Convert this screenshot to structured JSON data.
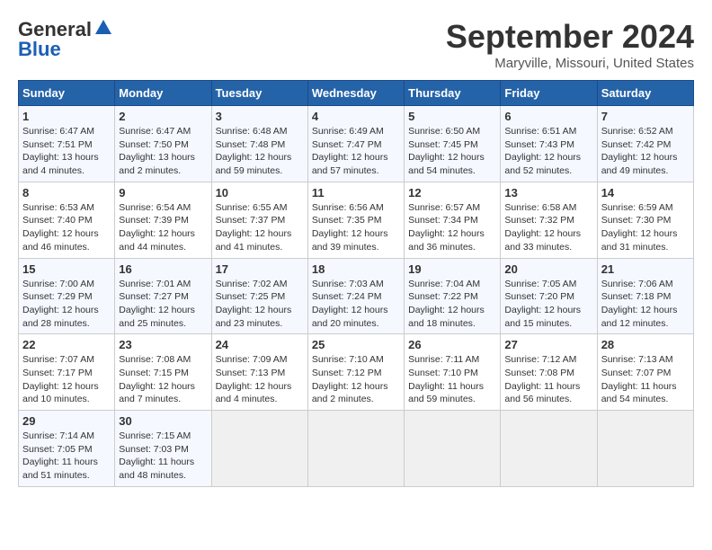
{
  "header": {
    "logo_general": "General",
    "logo_blue": "Blue",
    "month_title": "September 2024",
    "location": "Maryville, Missouri, United States"
  },
  "days_of_week": [
    "Sunday",
    "Monday",
    "Tuesday",
    "Wednesday",
    "Thursday",
    "Friday",
    "Saturday"
  ],
  "weeks": [
    [
      {
        "day": "1",
        "sunrise": "6:47 AM",
        "sunset": "7:51 PM",
        "daylight": "13 hours and 4 minutes."
      },
      {
        "day": "2",
        "sunrise": "6:47 AM",
        "sunset": "7:50 PM",
        "daylight": "13 hours and 2 minutes."
      },
      {
        "day": "3",
        "sunrise": "6:48 AM",
        "sunset": "7:48 PM",
        "daylight": "12 hours and 59 minutes."
      },
      {
        "day": "4",
        "sunrise": "6:49 AM",
        "sunset": "7:47 PM",
        "daylight": "12 hours and 57 minutes."
      },
      {
        "day": "5",
        "sunrise": "6:50 AM",
        "sunset": "7:45 PM",
        "daylight": "12 hours and 54 minutes."
      },
      {
        "day": "6",
        "sunrise": "6:51 AM",
        "sunset": "7:43 PM",
        "daylight": "12 hours and 52 minutes."
      },
      {
        "day": "7",
        "sunrise": "6:52 AM",
        "sunset": "7:42 PM",
        "daylight": "12 hours and 49 minutes."
      }
    ],
    [
      {
        "day": "8",
        "sunrise": "6:53 AM",
        "sunset": "7:40 PM",
        "daylight": "12 hours and 46 minutes."
      },
      {
        "day": "9",
        "sunrise": "6:54 AM",
        "sunset": "7:39 PM",
        "daylight": "12 hours and 44 minutes."
      },
      {
        "day": "10",
        "sunrise": "6:55 AM",
        "sunset": "7:37 PM",
        "daylight": "12 hours and 41 minutes."
      },
      {
        "day": "11",
        "sunrise": "6:56 AM",
        "sunset": "7:35 PM",
        "daylight": "12 hours and 39 minutes."
      },
      {
        "day": "12",
        "sunrise": "6:57 AM",
        "sunset": "7:34 PM",
        "daylight": "12 hours and 36 minutes."
      },
      {
        "day": "13",
        "sunrise": "6:58 AM",
        "sunset": "7:32 PM",
        "daylight": "12 hours and 33 minutes."
      },
      {
        "day": "14",
        "sunrise": "6:59 AM",
        "sunset": "7:30 PM",
        "daylight": "12 hours and 31 minutes."
      }
    ],
    [
      {
        "day": "15",
        "sunrise": "7:00 AM",
        "sunset": "7:29 PM",
        "daylight": "12 hours and 28 minutes."
      },
      {
        "day": "16",
        "sunrise": "7:01 AM",
        "sunset": "7:27 PM",
        "daylight": "12 hours and 25 minutes."
      },
      {
        "day": "17",
        "sunrise": "7:02 AM",
        "sunset": "7:25 PM",
        "daylight": "12 hours and 23 minutes."
      },
      {
        "day": "18",
        "sunrise": "7:03 AM",
        "sunset": "7:24 PM",
        "daylight": "12 hours and 20 minutes."
      },
      {
        "day": "19",
        "sunrise": "7:04 AM",
        "sunset": "7:22 PM",
        "daylight": "12 hours and 18 minutes."
      },
      {
        "day": "20",
        "sunrise": "7:05 AM",
        "sunset": "7:20 PM",
        "daylight": "12 hours and 15 minutes."
      },
      {
        "day": "21",
        "sunrise": "7:06 AM",
        "sunset": "7:18 PM",
        "daylight": "12 hours and 12 minutes."
      }
    ],
    [
      {
        "day": "22",
        "sunrise": "7:07 AM",
        "sunset": "7:17 PM",
        "daylight": "12 hours and 10 minutes."
      },
      {
        "day": "23",
        "sunrise": "7:08 AM",
        "sunset": "7:15 PM",
        "daylight": "12 hours and 7 minutes."
      },
      {
        "day": "24",
        "sunrise": "7:09 AM",
        "sunset": "7:13 PM",
        "daylight": "12 hours and 4 minutes."
      },
      {
        "day": "25",
        "sunrise": "7:10 AM",
        "sunset": "7:12 PM",
        "daylight": "12 hours and 2 minutes."
      },
      {
        "day": "26",
        "sunrise": "7:11 AM",
        "sunset": "7:10 PM",
        "daylight": "11 hours and 59 minutes."
      },
      {
        "day": "27",
        "sunrise": "7:12 AM",
        "sunset": "7:08 PM",
        "daylight": "11 hours and 56 minutes."
      },
      {
        "day": "28",
        "sunrise": "7:13 AM",
        "sunset": "7:07 PM",
        "daylight": "11 hours and 54 minutes."
      }
    ],
    [
      {
        "day": "29",
        "sunrise": "7:14 AM",
        "sunset": "7:05 PM",
        "daylight": "11 hours and 51 minutes."
      },
      {
        "day": "30",
        "sunrise": "7:15 AM",
        "sunset": "7:03 PM",
        "daylight": "11 hours and 48 minutes."
      },
      null,
      null,
      null,
      null,
      null
    ]
  ]
}
